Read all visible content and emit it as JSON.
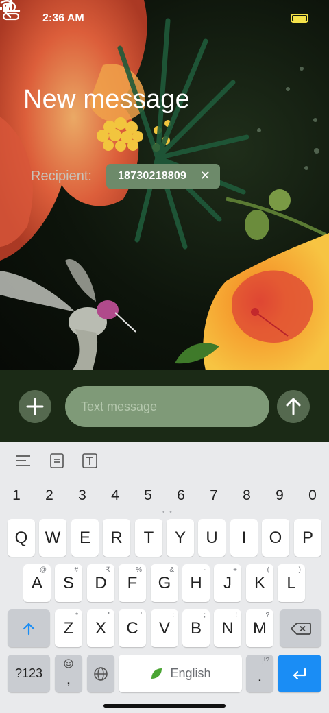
{
  "status_bar": {
    "time": "2:36 AM",
    "signal_icon": "signal-icon",
    "wifi_icon": "wifi-icon",
    "battery_icon": "battery-icon"
  },
  "header": {
    "back_icon": "arrow-left-icon",
    "title": "New message"
  },
  "recipient": {
    "label": "Recipient:",
    "chip_value": "18730218809",
    "chip_remove": "✕",
    "contact_icon": "person-icon"
  },
  "compose": {
    "add_icon": "plus-icon",
    "placeholder": "Text message",
    "send_icon": "arrow-up-icon"
  },
  "keyboard": {
    "toolbar_icons": [
      "menu-lines-icon",
      "clipboard-icon",
      "text-format-icon"
    ],
    "number_row": [
      "1",
      "2",
      "3",
      "4",
      "5",
      "6",
      "7",
      "8",
      "9",
      "0"
    ],
    "row1": [
      "Q",
      "W",
      "E",
      "R",
      "T",
      "Y",
      "U",
      "I",
      "O",
      "P"
    ],
    "row2": [
      {
        "key": "A",
        "hint": "@"
      },
      {
        "key": "S",
        "hint": "#"
      },
      {
        "key": "D",
        "hint": "₹"
      },
      {
        "key": "F",
        "hint": "%"
      },
      {
        "key": "G",
        "hint": "&"
      },
      {
        "key": "H",
        "hint": "-"
      },
      {
        "key": "J",
        "hint": "+"
      },
      {
        "key": "K",
        "hint": "("
      },
      {
        "key": "L",
        "hint": ")"
      }
    ],
    "row3": [
      {
        "key": "Z",
        "hint": "*"
      },
      {
        "key": "X",
        "hint": "\""
      },
      {
        "key": "C",
        "hint": "'"
      },
      {
        "key": "V",
        "hint": ":"
      },
      {
        "key": "B",
        "hint": ";"
      },
      {
        "key": "N",
        "hint": "!"
      },
      {
        "key": "M",
        "hint": "?"
      }
    ],
    "symbols_key": "?123",
    "comma_key": ",",
    "space_label": "English",
    "period_key": ".",
    "period_hint": ",!?",
    "accent_color": "#1a8df5"
  }
}
